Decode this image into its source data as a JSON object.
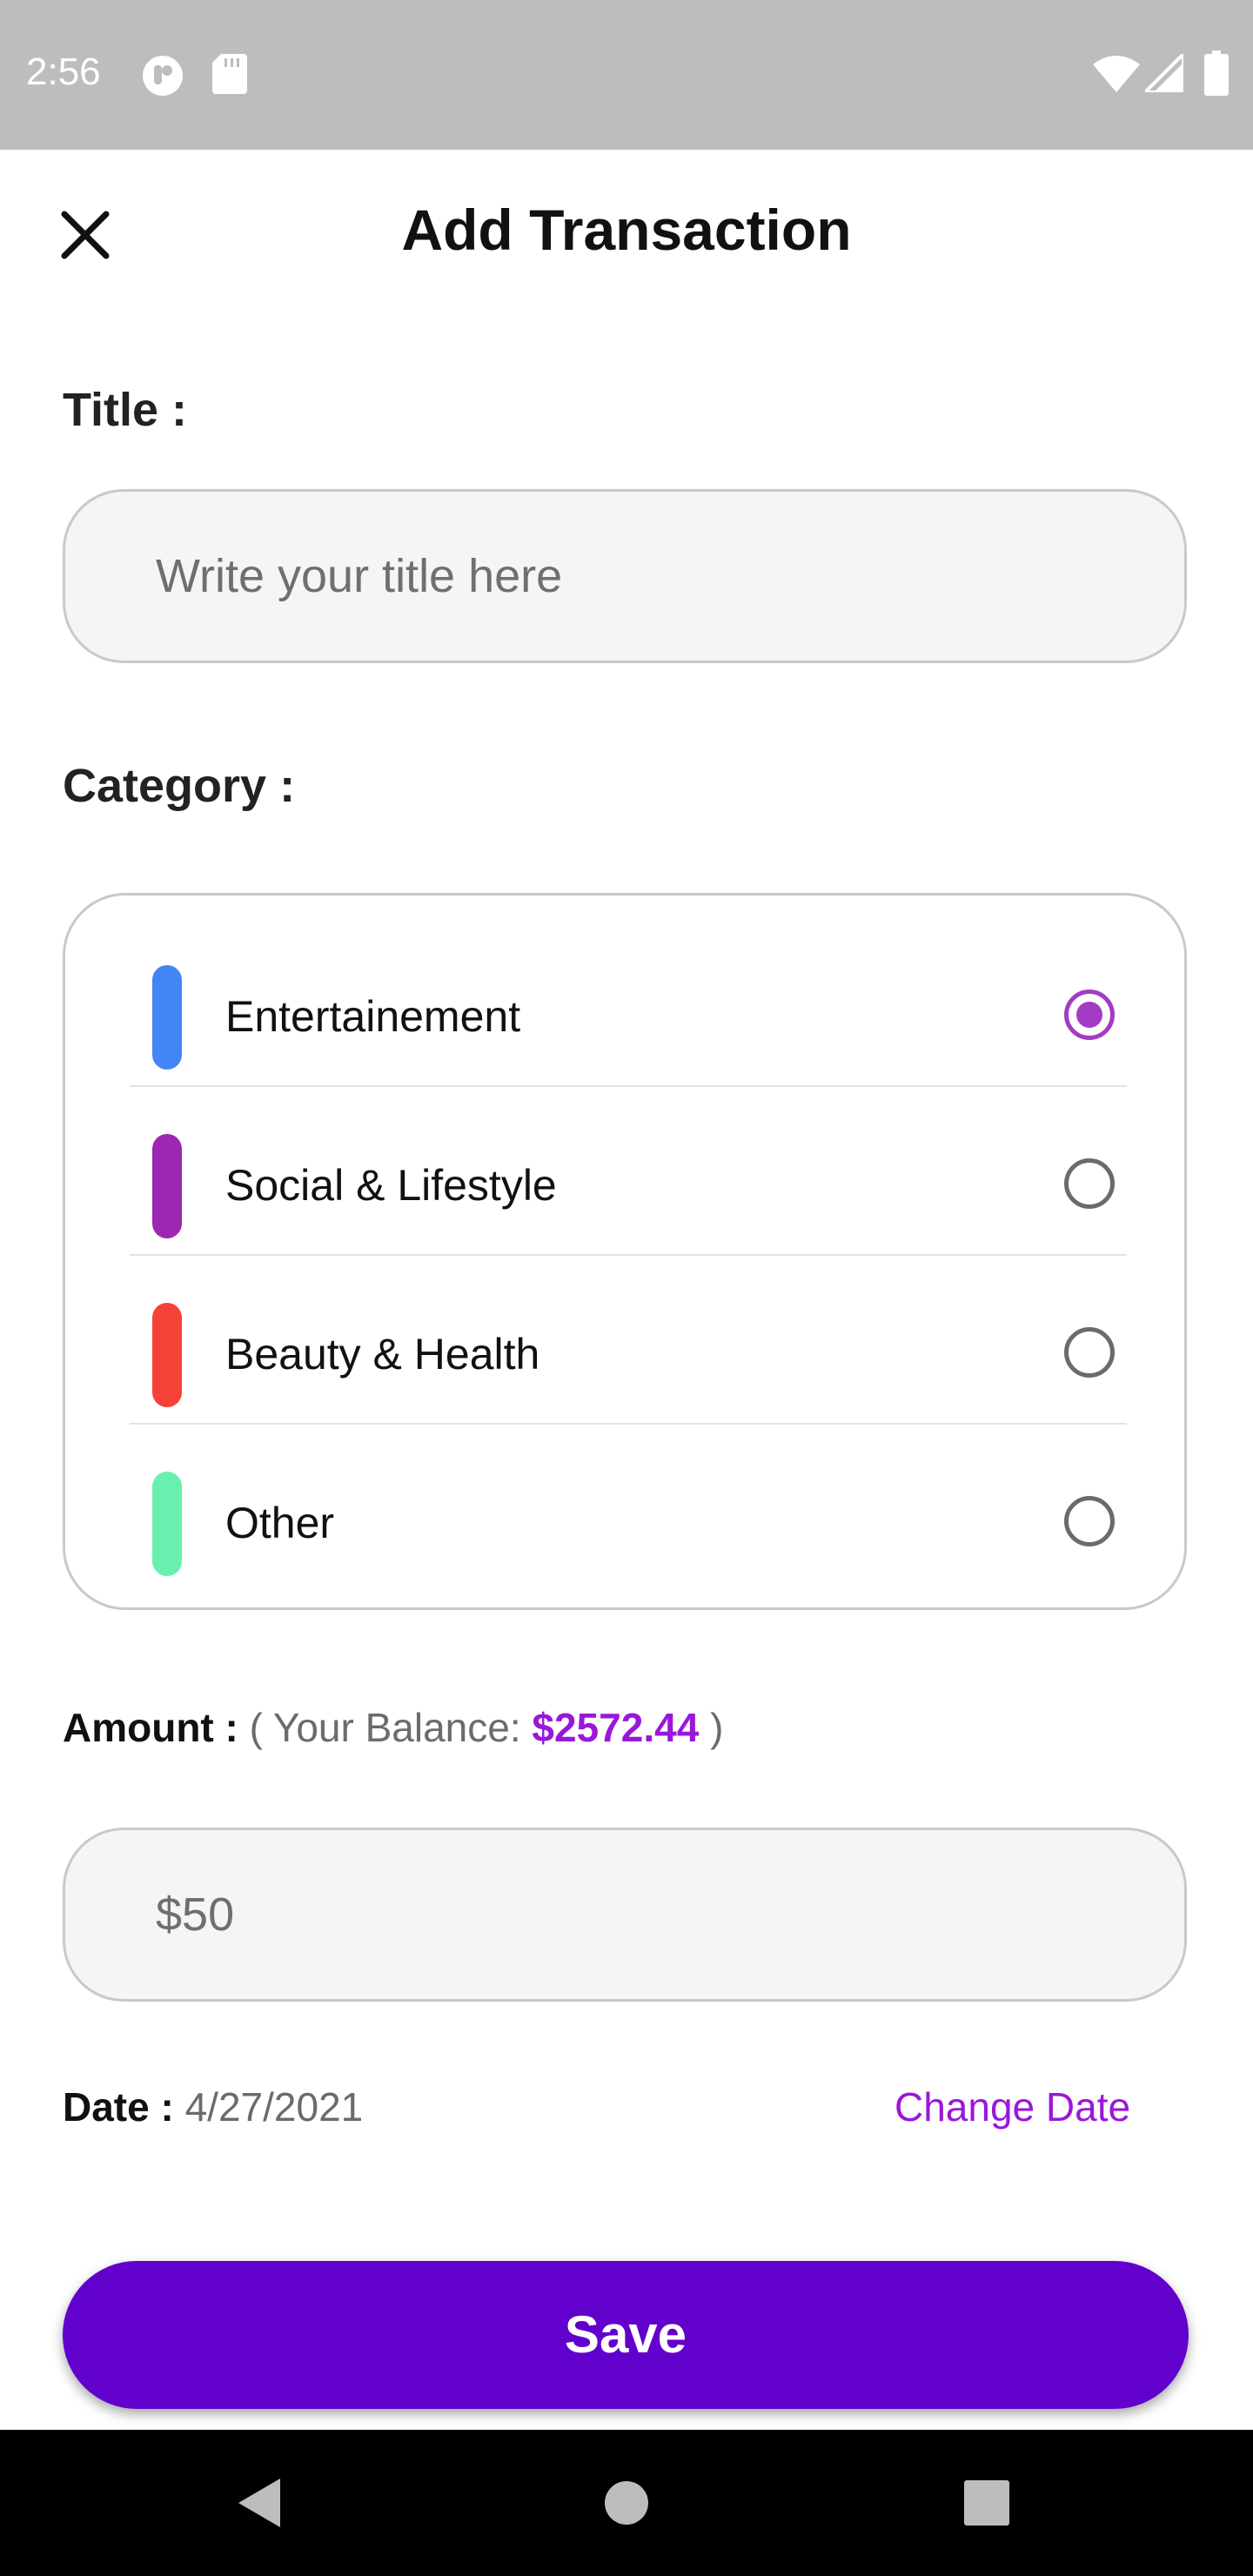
{
  "status_bar": {
    "time": "2:56",
    "icons": [
      "app-notification-icon",
      "sd-card-icon",
      "wifi-icon",
      "signal-icon",
      "battery-icon"
    ]
  },
  "header": {
    "title": "Add Transaction",
    "close_icon": "close-icon"
  },
  "title_field": {
    "label": "Title :",
    "placeholder": "Write your title here",
    "value": ""
  },
  "category": {
    "label": "Category :",
    "items": [
      {
        "label": "Entertainement",
        "color": "#4285f4",
        "selected": true
      },
      {
        "label": "Social & Lifestyle",
        "color": "#9c27b0",
        "selected": false
      },
      {
        "label": "Beauty & Health",
        "color": "#f44336",
        "selected": false
      },
      {
        "label": "Other",
        "color": "#69f0ae",
        "selected": false
      }
    ]
  },
  "amount": {
    "label": "Amount :",
    "balance_prefix": "( Your Balance:",
    "balance_value": "$2572.44",
    "balance_suffix": ")",
    "placeholder": "$50",
    "value": ""
  },
  "date": {
    "label": "Date :",
    "value": "4/27/2021",
    "change_label": "Change Date"
  },
  "save_label": "Save",
  "nav_bar": {
    "icons": [
      "back-icon",
      "home-icon",
      "recents-icon"
    ]
  },
  "colors": {
    "accent": "#6200cc",
    "highlight": "#9a17d9",
    "radio_selected": "#a23cc4"
  }
}
